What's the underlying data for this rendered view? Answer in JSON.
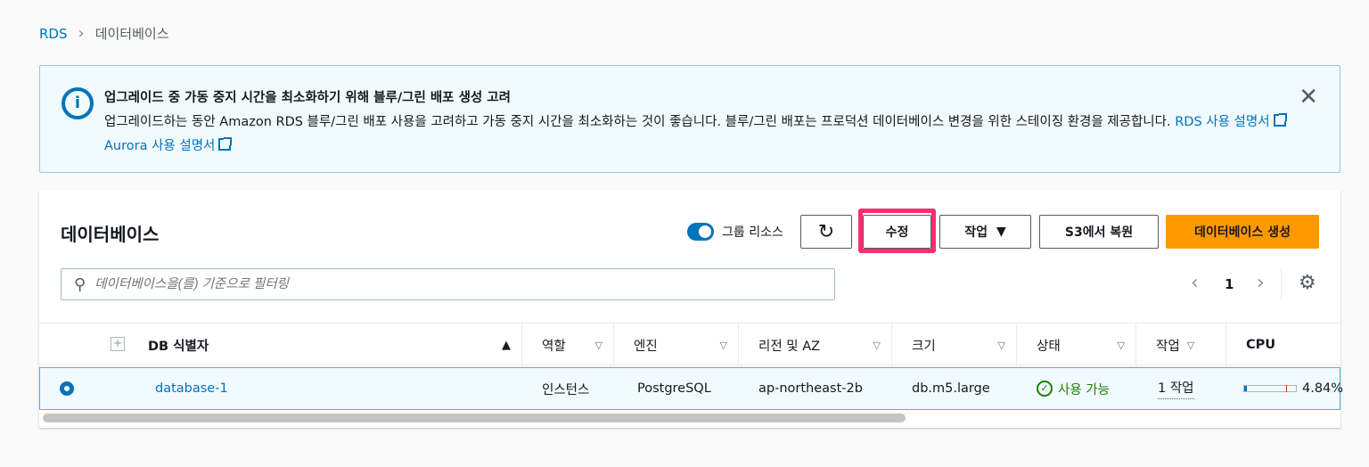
{
  "breadcrumb": {
    "root": "RDS",
    "current": "데이터베이스"
  },
  "alert": {
    "title": "업그레이드 중 가동 중지 시간을 최소화하기 위해 블루/그린 배포 생성 고려",
    "body": "업그레이드하는 동안 Amazon RDS 블루/그린 배포 사용을 고려하고 가동 중지 시간을 최소화하는 것이 좋습니다. 블루/그린 배포는 프로덕션 데이터베이스 변경을 위한 스테이징 환경을 제공합니다.",
    "link1": "RDS 사용 설명서",
    "link2": "Aurora 사용 설명서"
  },
  "panel": {
    "title": "데이터베이스",
    "group_label": "그룹 리소스",
    "modify": "수정",
    "actions": "작업",
    "restore": "S3에서 복원",
    "create": "데이터베이스 생성",
    "search_placeholder": "데이터베이스을(를) 기준으로 필터링",
    "page": "1"
  },
  "columns": [
    "DB 식별자",
    "역할",
    "엔진",
    "리전 및 AZ",
    "크기",
    "상태",
    "작업",
    "CPU"
  ],
  "rows": [
    {
      "id": "database-1",
      "role": "인스턴스",
      "engine": "PostgreSQL",
      "region": "ap-northeast-2b",
      "size": "db.m5.large",
      "status": "사용 가능",
      "actions": "1 작업",
      "cpu": "4.84%",
      "cpu_value": 4.84
    }
  ],
  "colors": {
    "accent": "#0073bb",
    "primary": "#ec7211",
    "highlight": "#ff2d6b",
    "success": "#1d8102"
  }
}
